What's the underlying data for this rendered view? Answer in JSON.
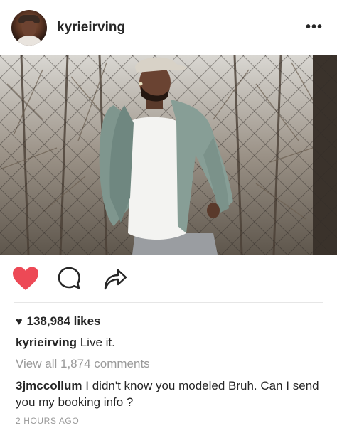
{
  "post": {
    "username": "kyrieirving",
    "likes_text": "138,984 likes",
    "caption_user": "kyrieirving",
    "caption_text": " Live it.",
    "view_all_comments": "View all 1,874 comments",
    "comment_user": "3jmccollum",
    "comment_text": " I didn't know you modeled Bruh. Can I send you my booking info ?",
    "timestamp": "2 HOURS AGO"
  },
  "header": {
    "more_label": "•••"
  },
  "icons": {
    "like": "heart-filled-icon",
    "comment": "speech-bubble-icon",
    "share": "share-arrow-icon",
    "likes_prefix": "small-heart-icon",
    "more": "ellipsis-icon"
  },
  "colors": {
    "like_red": "#ed4956",
    "text": "#262626",
    "muted": "#999999",
    "divider": "#e6e6e6"
  }
}
